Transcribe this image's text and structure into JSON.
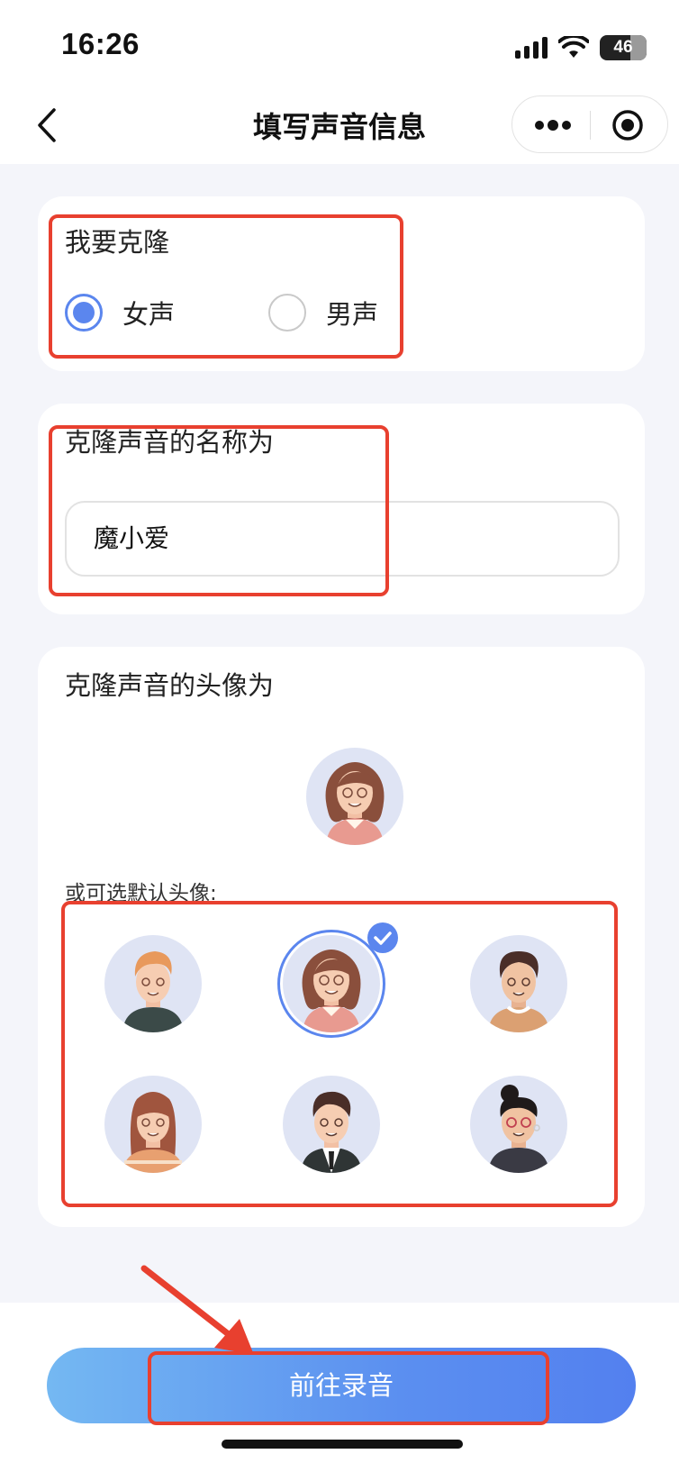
{
  "status_bar": {
    "time": "16:26",
    "battery": "46"
  },
  "nav": {
    "title": "填写声音信息"
  },
  "gender": {
    "title": "我要克隆",
    "options": [
      {
        "label": "女声",
        "checked": true
      },
      {
        "label": "男声",
        "checked": false
      }
    ]
  },
  "name": {
    "title": "克隆声音的名称为",
    "value": "魔小爱"
  },
  "avatar": {
    "title": "克隆声音的头像为",
    "default_label": "或可选默认头像:",
    "selected_index": 1,
    "defaults": [
      {
        "icon": "man-blond-avatar-icon"
      },
      {
        "icon": "woman-curly-avatar-icon"
      },
      {
        "icon": "man-curly-avatar-icon"
      },
      {
        "icon": "woman-long-hair-avatar-icon"
      },
      {
        "icon": "man-suit-avatar-icon"
      },
      {
        "icon": "woman-bun-avatar-icon"
      }
    ]
  },
  "footer": {
    "button_label": "前往录音"
  },
  "colors": {
    "accent": "#5b86ee",
    "highlight": "#e8402f"
  }
}
